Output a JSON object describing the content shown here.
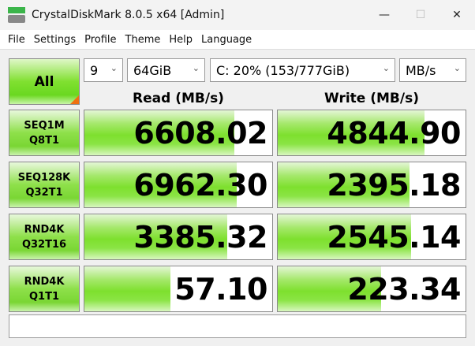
{
  "window": {
    "title": "CrystalDiskMark 8.0.5 x64 [Admin]",
    "minimize": "—",
    "maximize": "☐",
    "close": "✕"
  },
  "menu": [
    "File",
    "Settings",
    "Profile",
    "Theme",
    "Help",
    "Language"
  ],
  "controls": {
    "all_label": "All",
    "count": "9",
    "size": "64GiB",
    "drive": "C: 20% (153/777GiB)",
    "unit": "MB/s",
    "chevron": "⌄"
  },
  "headers": {
    "read": "Read (MB/s)",
    "write": "Write (MB/s)"
  },
  "rows": [
    {
      "line1": "SEQ1M",
      "line2": "Q8T1",
      "read": "6608.02",
      "write": "4844.90",
      "read_fill": 0.8,
      "write_fill": 0.78
    },
    {
      "line1": "SEQ128K",
      "line2": "Q32T1",
      "read": "6962.30",
      "write": "2395.18",
      "read_fill": 0.81,
      "write_fill": 0.7
    },
    {
      "line1": "RND4K",
      "line2": "Q32T16",
      "read": "3385.32",
      "write": "2545.14",
      "read_fill": 0.76,
      "write_fill": 0.71
    },
    {
      "line1": "RND4K",
      "line2": "Q1T1",
      "read": "57.10",
      "write": "223.34",
      "read_fill": 0.46,
      "write_fill": 0.55
    }
  ],
  "comment": ""
}
